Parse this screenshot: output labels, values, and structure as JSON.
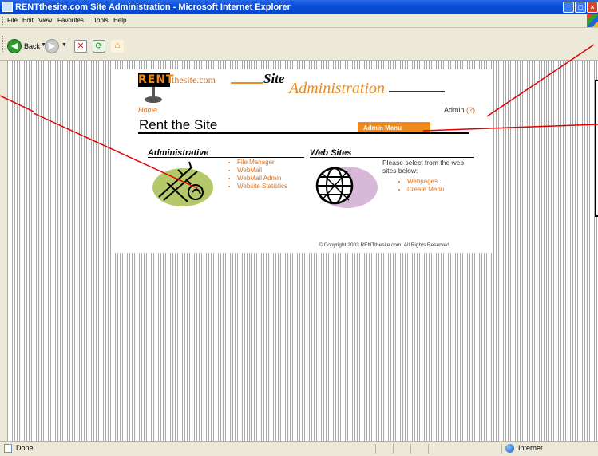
{
  "window": {
    "title": "RENTthesite.com Site Administration - Microsoft Internet Explorer"
  },
  "menubar": {
    "items": [
      "File",
      "Edit",
      "View",
      "Favorites",
      "Tools",
      "Help"
    ]
  },
  "toolbar": {
    "back_label": "Back"
  },
  "page": {
    "logo_rent": "RENT",
    "logo_thesite": "thesite.com",
    "header_site": "Site",
    "header_admin": "Administration",
    "home_link": "Home",
    "admin_label": "Admin",
    "admin_help": "(?)",
    "title": "Rent the Site",
    "admin_menu": "Admin Menu",
    "administrative": {
      "heading": "Administrative",
      "links": [
        "File Manager",
        "WebMail",
        "WebMail Admin",
        "Website Statistics"
      ]
    },
    "websites": {
      "heading": "Web Sites",
      "intro": "Please select from the web sites below:",
      "links": [
        "Webpages",
        "Create Menu"
      ]
    },
    "copyright": "© Copyright 2003 RENTthesite.com. All Rights Reserved."
  },
  "statusbar": {
    "status": "Done",
    "zone": "Internet"
  },
  "colors": {
    "accent_orange": "#f08a1c",
    "titlebar_blue": "#0a4fd8",
    "callout_red": "#e00000"
  }
}
